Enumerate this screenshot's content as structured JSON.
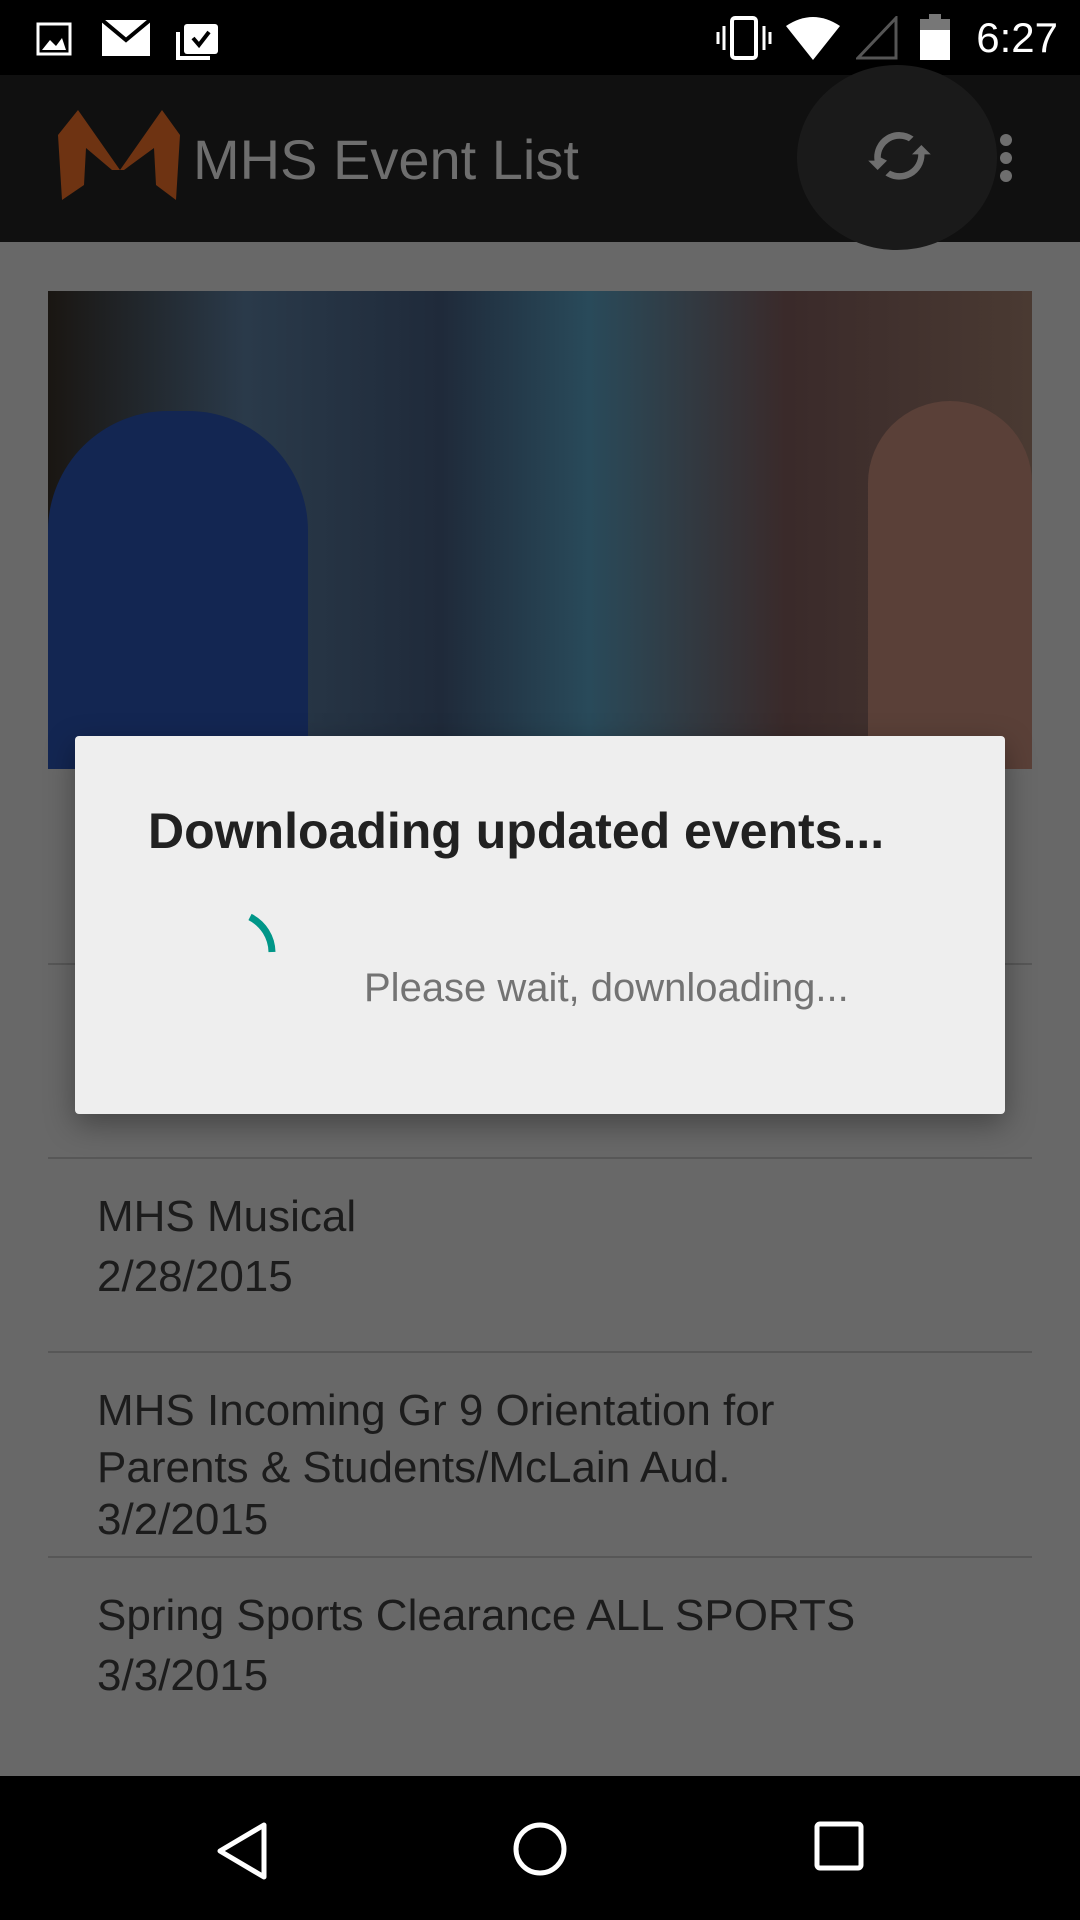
{
  "status_bar": {
    "time": "6:27",
    "icons": [
      "image-icon",
      "mail-icon",
      "clipboard-check-icon",
      "vibrate-icon",
      "wifi-icon",
      "cell-signal-icon",
      "battery-icon"
    ]
  },
  "app_bar": {
    "title": "MHS Event List",
    "logo_letter": "M",
    "logo_color": "#6e3312",
    "actions": [
      "refresh-icon",
      "more-vert-icon"
    ]
  },
  "events": [
    {
      "title": "MHS Musical",
      "date": "2/28/2015"
    },
    {
      "title": "MHS Incoming Gr 9 Orientation for Parents & Students/McLain Aud.",
      "date": "3/2/2015"
    },
    {
      "title": "Spring Sports Clearance ALL SPORTS",
      "date": "3/3/2015"
    }
  ],
  "dialog": {
    "title": "Downloading updated events...",
    "message": "Please wait, downloading...",
    "spinner_color": "#009688"
  },
  "nav_bar": {
    "icons": [
      "back-icon",
      "home-icon",
      "recents-icon"
    ]
  }
}
